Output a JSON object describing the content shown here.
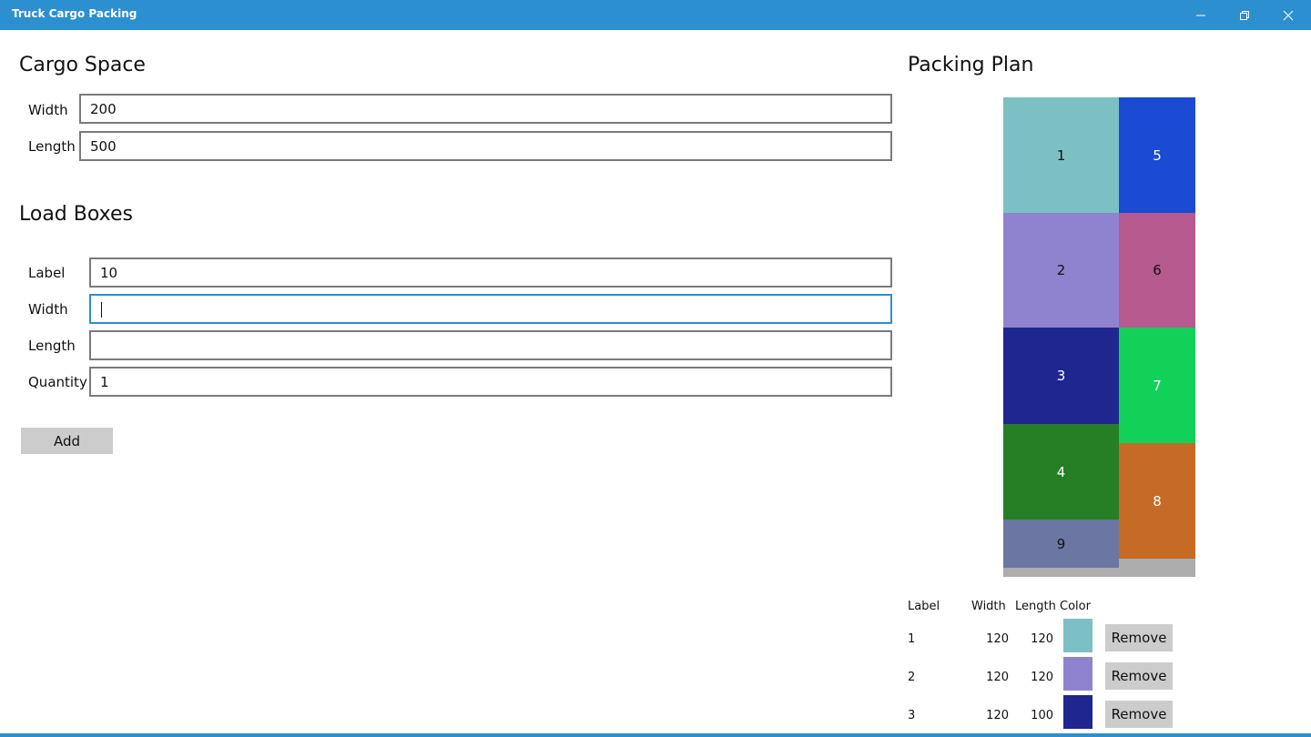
{
  "window": {
    "title": "Truck Cargo Packing"
  },
  "cargo_space": {
    "heading": "Cargo Space",
    "width_label": "Width",
    "width_value": "200",
    "length_label": "Length",
    "length_value": "500"
  },
  "load_boxes": {
    "heading": "Load Boxes",
    "label_label": "Label",
    "label_value": "10",
    "width_label": "Width",
    "width_value": "",
    "length_label": "Length",
    "length_value": "",
    "quantity_label": "Quantity",
    "quantity_value": "1",
    "add_label": "Add"
  },
  "packing_plan": {
    "heading": "Packing Plan",
    "boxes": [
      {
        "label": "1",
        "color": "#7cc0c4",
        "text_color": "#111111"
      },
      {
        "label": "2",
        "color": "#8f83cf",
        "text_color": "#111111"
      },
      {
        "label": "3",
        "color": "#1f2690",
        "text_color": "#ffffff"
      },
      {
        "label": "4",
        "color": "#267f24",
        "text_color": "#ffffff"
      },
      {
        "label": "9",
        "color": "#6b77a2",
        "text_color": "#111111"
      },
      {
        "label": "5",
        "color": "#1a4bd2",
        "text_color": "#ffffff"
      },
      {
        "label": "6",
        "color": "#b5598e",
        "text_color": "#111111"
      },
      {
        "label": "7",
        "color": "#12d159",
        "text_color": "#ffffff"
      },
      {
        "label": "8",
        "color": "#c56b26",
        "text_color": "#ffffff"
      }
    ]
  },
  "box_table": {
    "headers": {
      "label": "Label",
      "width": "Width",
      "length": "Length",
      "color": "Color"
    },
    "remove_label": "Remove",
    "rows": [
      {
        "label": "1",
        "width": "120",
        "length": "120",
        "color": "#7cc0c4"
      },
      {
        "label": "2",
        "width": "120",
        "length": "120",
        "color": "#8f83cf"
      },
      {
        "label": "3",
        "width": "120",
        "length": "100",
        "color": "#1f2690"
      }
    ]
  }
}
